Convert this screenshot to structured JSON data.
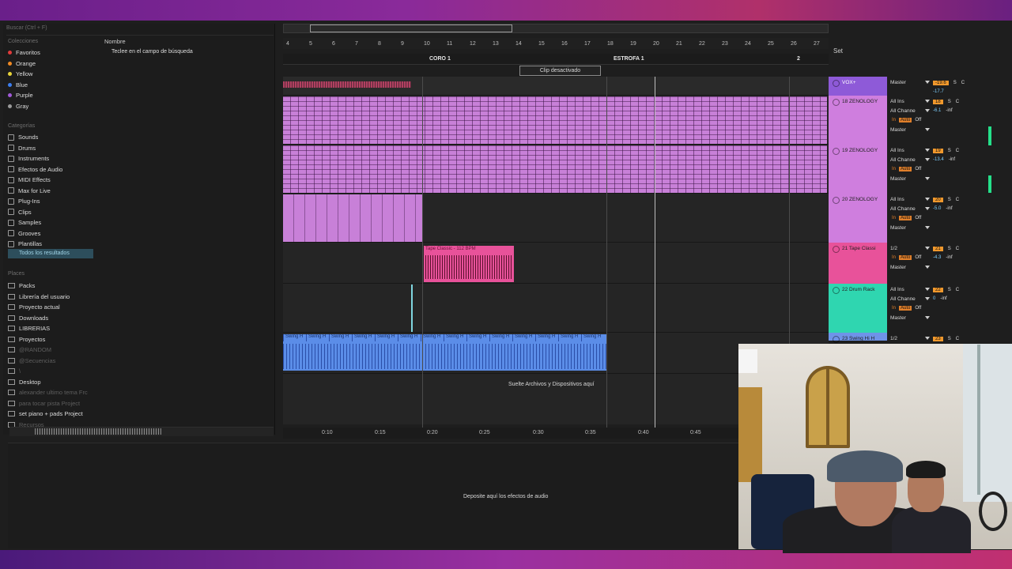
{
  "browser": {
    "search_placeholder": "Buscar (Ctrl + F)",
    "col_name": "Nombre",
    "hint": "Teclee en el campo de búsqueda",
    "collections_title": "Colecciones",
    "collections": [
      {
        "label": "Favoritos",
        "color": "#e23b3b"
      },
      {
        "label": "Orange",
        "color": "#f08a24"
      },
      {
        "label": "Yellow",
        "color": "#e8d43a"
      },
      {
        "label": "Blue",
        "color": "#3c7ef0"
      },
      {
        "label": "Purple",
        "color": "#a15ad8"
      },
      {
        "label": "Gray",
        "color": "#9a9a9a"
      }
    ],
    "categories_title": "Categorías",
    "categories": [
      "Sounds",
      "Drums",
      "Instruments",
      "Efectos de Audio",
      "MIDI Effects",
      "Max for Live",
      "Plug-Ins",
      "Clips",
      "Samples",
      "Grooves",
      "Plantillas"
    ],
    "selected_category": "Todos los resultados",
    "places_title": "Places",
    "places": [
      "Packs",
      "Librería del usuario",
      "Proyecto actual",
      "Downloads",
      "LIBRERIAS",
      "Proyectos",
      "@RANDOM",
      "@Secuencias",
      "\\",
      "Desktop",
      "alexander ultimo tema Frc",
      "para tocar pista Project",
      "set piano + pads Project",
      "Recursos"
    ]
  },
  "arrangement": {
    "bar_numbers": [
      "4",
      "5",
      "6",
      "7",
      "8",
      "9",
      "10",
      "11",
      "12",
      "13",
      "14",
      "15",
      "16",
      "17",
      "18",
      "19",
      "20",
      "21",
      "22",
      "23",
      "24",
      "25",
      "26",
      "27"
    ],
    "locators": [
      "CORO 1",
      "ESTROFA 1",
      "2"
    ],
    "clip_disabled": "Clip desactivado",
    "audio_clip_label": "Tape Classic - 112 BPM",
    "swing_clip_labels": [
      "Swing H",
      "Swing H",
      "Swing H",
      "Swing H",
      "Swing H",
      "Swing H",
      "Swing H",
      "Swing H",
      "Swing H",
      "Swing H",
      "Swing H",
      "Swing H",
      "Swing H",
      "Swing H"
    ],
    "drop_files": "Suelte Archivos y Dispositivos aquí",
    "time_ticks": [
      "0:10",
      "0:15",
      "0:20",
      "0:25",
      "0:30",
      "0:35",
      "0:40",
      "0:45"
    ],
    "drop_fx": "Deposite aquí los efectos de audio",
    "set_label": "Set"
  },
  "tracks": [
    {
      "name": "VOX+",
      "color": "#8e5ad8",
      "input": "Master",
      "num": "-19.6",
      "vol": "-17.7",
      "pan": "C"
    },
    {
      "name": "18 ZENOLOGY",
      "color": "#cf7ede",
      "input": "All Ins",
      "channel": "All Channe",
      "monitor": "Auto",
      "off": "Off",
      "output": "Master",
      "num": "18",
      "vol": "-6.1",
      "inf": "-inf",
      "pan": "C"
    },
    {
      "name": "19 ZENOLOGY",
      "color": "#cf7ede",
      "input": "All Ins",
      "channel": "All Channe",
      "monitor": "Auto",
      "off": "Off",
      "output": "Master",
      "num": "19",
      "vol": "-13.4",
      "inf": "-inf",
      "pan": "C"
    },
    {
      "name": "20 ZENOLOGY",
      "color": "#cf7ede",
      "input": "All Ins",
      "channel": "All Channe",
      "monitor": "Auto",
      "off": "Off",
      "output": "Master",
      "num": "20",
      "vol": "-5.0",
      "inf": "-inf",
      "pan": "C"
    },
    {
      "name": "21 Tape Classi",
      "color": "#e8529a",
      "input": "1/2",
      "monitor": "Auto",
      "off": "Off",
      "output": "Master",
      "num": "21",
      "vol": "-4.3",
      "inf": "-inf",
      "pan": "C"
    },
    {
      "name": "22 Drum Rack",
      "color": "#2fd6b0",
      "input": "All Ins",
      "channel": "All Channe",
      "monitor": "Auto",
      "off": "Off",
      "output": "Master",
      "num": "22",
      "vol": "0",
      "inf": "-inf",
      "pan": "C"
    },
    {
      "name": "23 Swing Hi H",
      "color": "#6f93e8",
      "input": "1/2",
      "num": "23",
      "pan": "C"
    }
  ],
  "mixer_labels": {
    "s": "S",
    "in": "In"
  },
  "colors": {
    "midi_clip": "#c880d8",
    "audio_clip": "#e8529a",
    "swing_clip": "#5b8de8",
    "accent": "#f0982c"
  }
}
